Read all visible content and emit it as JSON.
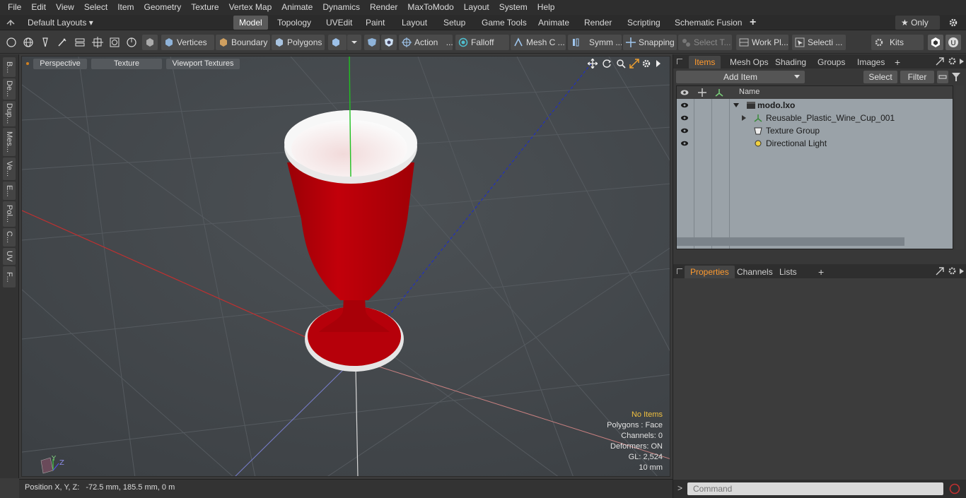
{
  "menu": [
    "File",
    "Edit",
    "View",
    "Select",
    "Item",
    "Geometry",
    "Texture",
    "Vertex Map",
    "Animate",
    "Dynamics",
    "Render",
    "MaxToModo",
    "Layout",
    "System",
    "Help"
  ],
  "layout_bar": {
    "layout_dropdown": "Default Layouts ▾",
    "tabs": [
      "Model",
      "Topology",
      "UVEdit",
      "Paint",
      "Layout",
      "Setup",
      "Game Tools",
      "Animate",
      "Render",
      "Scripting",
      "Schematic Fusion"
    ],
    "active_tab": "Model",
    "add_tab": "+",
    "only_label": "★ Only"
  },
  "toolbar": {
    "vertices": "Vertices",
    "boundary": "Boundary",
    "polygons": "Polygons",
    "action": "Action",
    "action_more": "...",
    "falloff": "Falloff",
    "mesh_c": "Mesh C ...",
    "symm": "Symm ...",
    "snapping": "Snapping",
    "select_t": "Select T...",
    "work_pl": "Work Pl...",
    "selecti": "Selecti ...",
    "kits": "Kits"
  },
  "left_tabs": [
    "B...",
    "De...",
    "Dup...",
    "Mes...",
    "Ve...",
    "E...",
    "Pol...",
    "C...",
    "UV",
    "F..."
  ],
  "viewport": {
    "buttons": [
      "Perspective",
      "Texture",
      "Viewport Textures"
    ],
    "info": {
      "no_items": "No Items",
      "polygons": "Polygons : Face",
      "channels": "Channels: 0",
      "deformers": "Deformers: ON",
      "gl": "GL: 2,524",
      "scale": "10 mm"
    },
    "axis_y": "Y",
    "axis_z": "Z"
  },
  "status": {
    "position_label": "Position X, Y, Z:",
    "position_value": "-72.5 mm, 185.5 mm, 0 m"
  },
  "items_panel": {
    "tabs": [
      "Items",
      "Mesh Ops",
      "Shading",
      "Groups",
      "Images"
    ],
    "active_tab": "Items",
    "add_tab": "+",
    "add_item": "Add Item",
    "select": "Select",
    "filter": "Filter",
    "column_name": "Name",
    "rows": [
      {
        "name": "modo.lxo"
      },
      {
        "name": "Reusable_Plastic_Wine_Cup_001"
      },
      {
        "name": "Texture Group"
      },
      {
        "name": "Directional Light"
      }
    ]
  },
  "properties_panel": {
    "tabs": [
      "Properties",
      "Channels",
      "Lists"
    ],
    "active_tab": "Properties",
    "add_tab": "+"
  },
  "command": {
    "prompt": ">",
    "placeholder": "Command"
  },
  "colors": {
    "accent": "#ff9a2e",
    "cup_red": "#b00008",
    "viewport_bg": "#45494d"
  }
}
